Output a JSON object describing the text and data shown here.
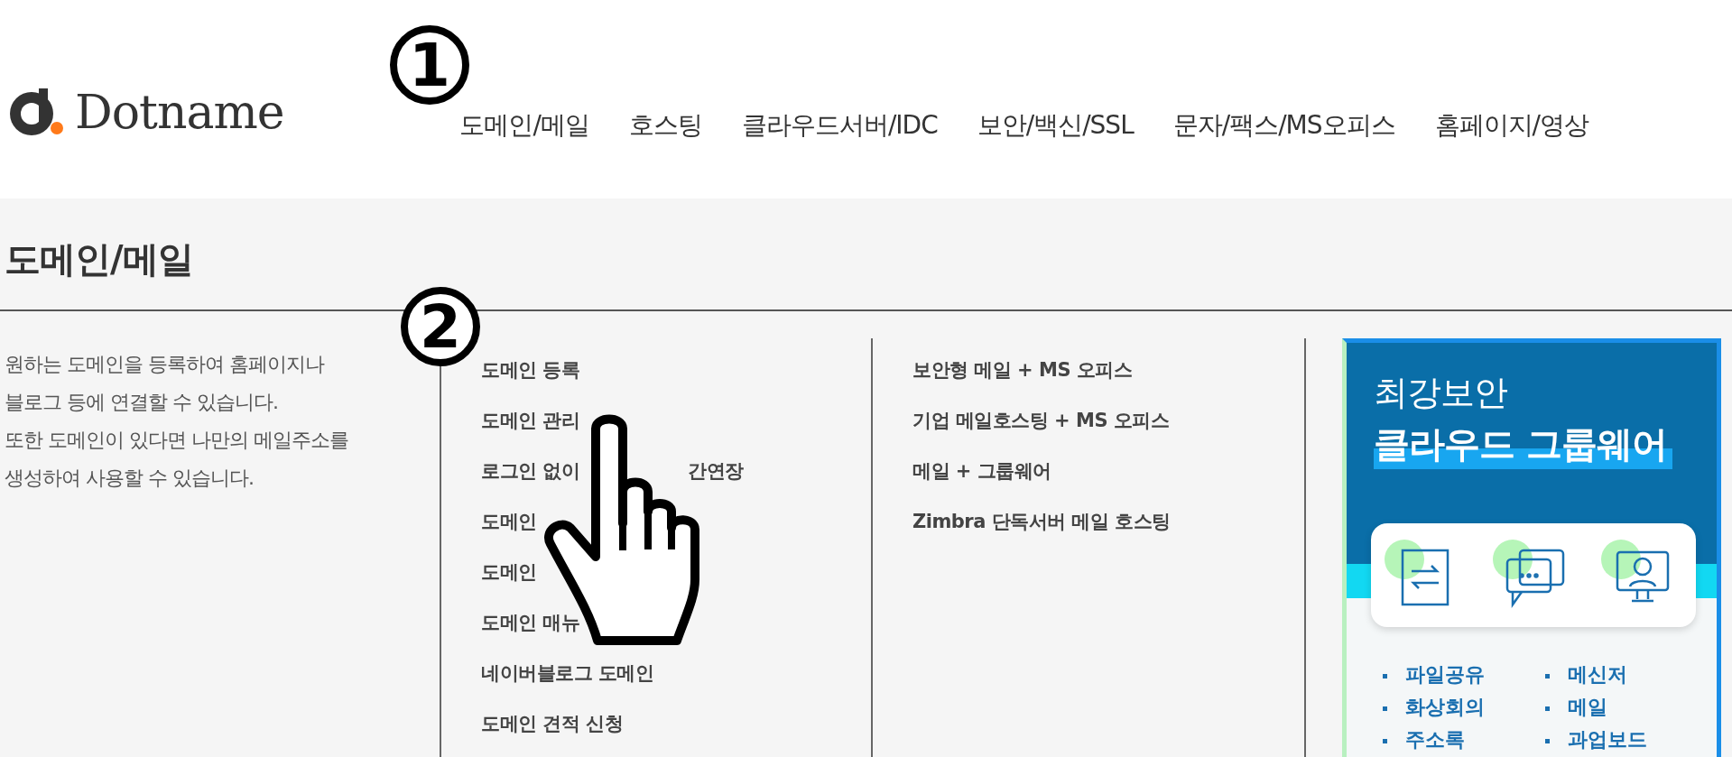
{
  "header": {
    "logo": "Dotname",
    "nav": [
      "도메인/메일",
      "호스팅",
      "클라우드서버/IDC",
      "보안/백신/SSL",
      "문자/팩스/MS오피스",
      "홈페이지/영상"
    ]
  },
  "annotations": [
    {
      "label": "1"
    },
    {
      "label": "2"
    }
  ],
  "panel": {
    "title": "도메인/메일",
    "description": [
      "원하는 도메인을 등록하여 홈페이지나",
      "블로그 등에 연결할 수 있습니다.",
      "또한 도메인이 있다면 나만의 메일주소를",
      "생성하여 사용할 수 있습니다."
    ],
    "menu": [
      [
        "도메인 등록"
      ],
      [
        "도메인 관리"
      ],
      [
        "로그인 없이",
        "간연장"
      ],
      [
        "도메인"
      ],
      [
        "도메인"
      ],
      [
        "도메인 매뉴"
      ],
      [
        "네이버블로그 도메인"
      ],
      [
        "도메인 견적 신청"
      ]
    ],
    "mail_menu": [
      "보안형 메일 + MS 오피스",
      "기업 메일호스팅 + MS 오피스",
      "메일 + 그룹웨어",
      "Zimbra 단독서버 메일 호스팅"
    ],
    "banner": {
      "line1": "최강보안",
      "line2": "클라우드 그룹웨어",
      "features": [
        "파일공유",
        "메신저",
        "화상회의",
        "메일",
        "주소록",
        "과업보드"
      ]
    }
  }
}
